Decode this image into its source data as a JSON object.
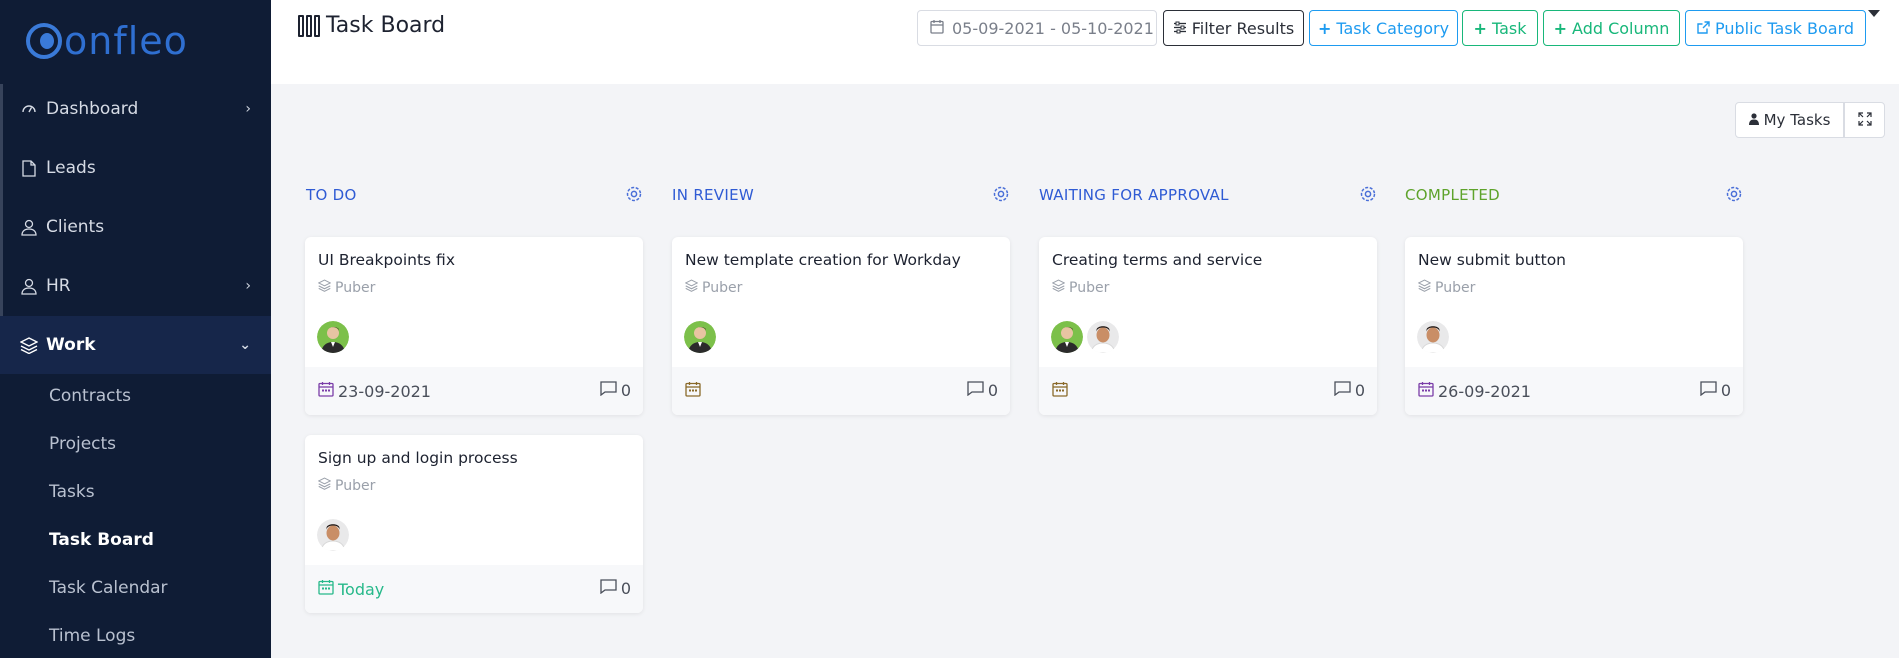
{
  "brand": {
    "logo_text": "onfleo"
  },
  "sidebar": {
    "items": [
      {
        "label": "Dashboard",
        "has_chevron": true
      },
      {
        "label": "Leads"
      },
      {
        "label": "Clients"
      },
      {
        "label": "HR",
        "has_chevron": true
      },
      {
        "label": "Work",
        "expanded": true
      }
    ],
    "work_sub": [
      "Contracts",
      "Projects",
      "Tasks",
      "Task Board",
      "Task Calendar",
      "Time Logs"
    ],
    "current_sub": "Task Board"
  },
  "header": {
    "title": "Task Board",
    "date_range": "05-09-2021 - 05-10-2021",
    "filter_label": "Filter Results",
    "task_category_label": "Task Category",
    "task_label": "Task",
    "add_column_label": "Add Column",
    "public_board_label": "Public Task Board"
  },
  "toolbar": {
    "my_tasks_label": "My Tasks"
  },
  "columns": [
    {
      "title": "TO DO",
      "color": "#2f5bd4",
      "cards": [
        {
          "title": "UI Breakpoints fix",
          "category": "Puber",
          "due": "23-09-2021",
          "comments": "0"
        },
        {
          "title": "Sign up and login process",
          "category": "Puber",
          "due": "Today",
          "comments": "0"
        }
      ]
    },
    {
      "title": "IN REVIEW",
      "color": "#2f5bd4",
      "cards": [
        {
          "title": "New template creation for Workday",
          "category": "Puber",
          "due": "",
          "comments": "0"
        }
      ]
    },
    {
      "title": "WAITING FOR APPROVAL",
      "color": "#2f5bd4",
      "cards": [
        {
          "title": "Creating terms and service",
          "category": "Puber",
          "due": "",
          "comments": "0"
        }
      ]
    },
    {
      "title": "COMPLETED",
      "color": "#5ea32b",
      "cards": [
        {
          "title": "New submit button",
          "category": "Puber",
          "due": "26-09-2021",
          "comments": "0"
        }
      ]
    }
  ],
  "colors": {
    "sidebar_bg": "#0f1c35",
    "accent_blue": "#1e9bf0",
    "accent_green": "#18b77a",
    "today_green": "#27b98a"
  }
}
